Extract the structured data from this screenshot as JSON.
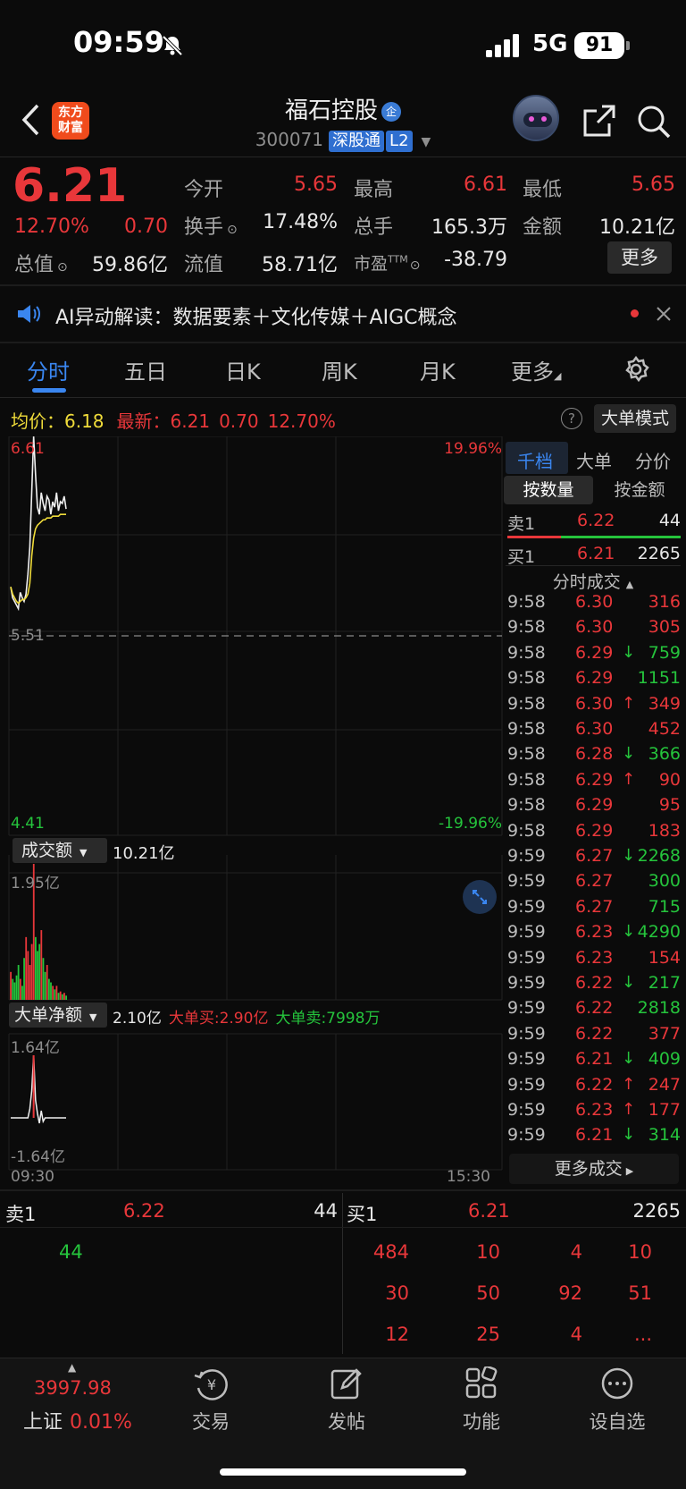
{
  "status": {
    "time": "09:59",
    "network": "5G",
    "battery": "91"
  },
  "header": {
    "logo_line1": "东方",
    "logo_line2": "财富",
    "stock_name": "福石控股",
    "badge": "企",
    "code": "300071",
    "tag": "深股通",
    "level": "L2"
  },
  "quote": {
    "price": "6.21",
    "pct": "12.70%",
    "change": "0.70",
    "open_label": "今开",
    "open": "5.65",
    "high_label": "最高",
    "high": "6.61",
    "low_label": "最低",
    "low": "5.65",
    "turnover_label": "换手",
    "turnover": "17.48%",
    "volume_label": "总手",
    "volume": "165.3万",
    "amount_label": "金额",
    "amount": "10.21亿",
    "mktcap_label": "总值",
    "mktcap": "59.86亿",
    "float_label": "流值",
    "float": "58.71亿",
    "pe_label": "市盈",
    "pe_sup": "TTM",
    "pe": "-38.79",
    "more": "更多"
  },
  "banner": {
    "text": "AI异动解读：数据要素＋文化传媒＋AIGC概念"
  },
  "tabs": [
    "分时",
    "五日",
    "日K",
    "周K",
    "月K",
    "更多"
  ],
  "info": {
    "avg_label": "均价：",
    "avg": "6.18",
    "latest_label": "最新：",
    "latest": "6.21",
    "change": "0.70",
    "pct": "12.70%",
    "mode": "大单模式",
    "help": "?"
  },
  "chart": {
    "top_price": "6.61",
    "top_pct": "19.96%",
    "mid_price": "5.51",
    "bot_price": "4.41",
    "bot_pct": "-19.96%",
    "vol_label": "成交额",
    "vol_total": "10.21亿",
    "vol_max": "1.95亿",
    "net_label": "大单净额",
    "net_total": "2.10亿",
    "net_buy": "大单买:2.90亿",
    "net_sell": "大单卖:7998万",
    "net_max": "1.64亿",
    "net_min": "-1.64亿",
    "start_time": "09:30",
    "end_time": "15:30"
  },
  "chart_data": {
    "type": "line",
    "x_range": [
      "09:30",
      "15:30"
    ],
    "ylim": [
      4.41,
      6.61
    ],
    "prev_close": 5.51,
    "price": [
      5.78,
      5.72,
      5.7,
      5.68,
      5.66,
      5.75,
      5.72,
      5.7,
      5.74,
      5.85,
      6.0,
      6.3,
      6.61,
      6.4,
      6.22,
      6.18,
      6.3,
      6.24,
      6.2,
      6.28,
      6.26,
      6.18,
      6.25,
      6.22,
      6.3,
      6.2,
      6.25,
      6.24,
      6.28,
      6.21
    ],
    "avg_price": [
      5.78,
      5.74,
      5.72,
      5.7,
      5.69,
      5.7,
      5.71,
      5.71,
      5.72,
      5.74,
      5.8,
      5.95,
      6.05,
      6.1,
      6.12,
      6.13,
      6.14,
      6.15,
      6.15,
      6.16,
      6.16,
      6.16,
      6.17,
      6.17,
      6.17,
      6.17,
      6.18,
      6.18,
      6.18,
      6.18
    ],
    "turnover_yi": [
      0.4,
      0.3,
      0.25,
      0.35,
      0.5,
      0.3,
      0.2,
      0.6,
      0.9,
      0.7,
      0.5,
      0.8,
      1.95,
      0.9,
      0.7,
      0.8,
      1.0,
      0.6,
      0.4,
      0.5,
      0.3,
      0.25,
      0.2,
      0.15,
      0.2,
      0.1,
      0.12,
      0.08,
      0.1,
      0.06
    ]
  },
  "right_panel": {
    "tabs": [
      "千档",
      "大单",
      "分价"
    ],
    "seg": [
      "按数量",
      "按金额"
    ],
    "sell1": {
      "label": "卖1",
      "price": "6.22",
      "vol": "44"
    },
    "buy1": {
      "label": "买1",
      "price": "6.21",
      "vol": "2265"
    },
    "title": "分时成交",
    "more": "更多成交",
    "trades": [
      {
        "time": "9:58",
        "price": "6.30",
        "arrow": "",
        "vol": "316",
        "pc": "red",
        "vc": "red"
      },
      {
        "time": "9:58",
        "price": "6.30",
        "arrow": "",
        "vol": "305",
        "pc": "red",
        "vc": "red"
      },
      {
        "time": "9:58",
        "price": "6.29",
        "arrow": "↓",
        "vol": "759",
        "pc": "red",
        "vc": "green"
      },
      {
        "time": "9:58",
        "price": "6.29",
        "arrow": "",
        "vol": "1151",
        "pc": "red",
        "vc": "green"
      },
      {
        "time": "9:58",
        "price": "6.30",
        "arrow": "↑",
        "vol": "349",
        "pc": "red",
        "vc": "red"
      },
      {
        "time": "9:58",
        "price": "6.30",
        "arrow": "",
        "vol": "452",
        "pc": "red",
        "vc": "red"
      },
      {
        "time": "9:58",
        "price": "6.28",
        "arrow": "↓",
        "vol": "366",
        "pc": "red",
        "vc": "green"
      },
      {
        "time": "9:58",
        "price": "6.29",
        "arrow": "↑",
        "vol": "90",
        "pc": "red",
        "vc": "red"
      },
      {
        "time": "9:58",
        "price": "6.29",
        "arrow": "",
        "vol": "95",
        "pc": "red",
        "vc": "red"
      },
      {
        "time": "9:58",
        "price": "6.29",
        "arrow": "",
        "vol": "183",
        "pc": "red",
        "vc": "red"
      },
      {
        "time": "9:59",
        "price": "6.27",
        "arrow": "↓",
        "vol": "2268",
        "pc": "red",
        "vc": "green"
      },
      {
        "time": "9:59",
        "price": "6.27",
        "arrow": "",
        "vol": "300",
        "pc": "red",
        "vc": "green"
      },
      {
        "time": "9:59",
        "price": "6.27",
        "arrow": "",
        "vol": "715",
        "pc": "red",
        "vc": "green"
      },
      {
        "time": "9:59",
        "price": "6.23",
        "arrow": "↓",
        "vol": "4290",
        "pc": "red",
        "vc": "green"
      },
      {
        "time": "9:59",
        "price": "6.23",
        "arrow": "",
        "vol": "154",
        "pc": "red",
        "vc": "red"
      },
      {
        "time": "9:59",
        "price": "6.22",
        "arrow": "↓",
        "vol": "217",
        "pc": "red",
        "vc": "green"
      },
      {
        "time": "9:59",
        "price": "6.22",
        "arrow": "",
        "vol": "2818",
        "pc": "red",
        "vc": "green"
      },
      {
        "time": "9:59",
        "price": "6.22",
        "arrow": "",
        "vol": "377",
        "pc": "red",
        "vc": "red"
      },
      {
        "time": "9:59",
        "price": "6.21",
        "arrow": "↓",
        "vol": "409",
        "pc": "red",
        "vc": "green"
      },
      {
        "time": "9:59",
        "price": "6.22",
        "arrow": "↑",
        "vol": "247",
        "pc": "red",
        "vc": "red"
      },
      {
        "time": "9:59",
        "price": "6.23",
        "arrow": "↑",
        "vol": "177",
        "pc": "red",
        "vc": "red"
      },
      {
        "time": "9:59",
        "price": "6.21",
        "arrow": "↓",
        "vol": "314",
        "pc": "red",
        "vc": "green"
      }
    ]
  },
  "depth": {
    "sell_label": "卖1",
    "sell_price": "6.22",
    "sell_vol": "44",
    "buy_label": "买1",
    "buy_price": "6.21",
    "buy_vol": "2265",
    "sell_orders": [
      "44"
    ],
    "buy_orders": [
      [
        "484",
        "10",
        "4",
        "10"
      ],
      [
        "30",
        "50",
        "92",
        "51"
      ],
      [
        "12",
        "25",
        "4",
        "..."
      ]
    ]
  },
  "nav": {
    "index_value": "3997.98",
    "index_name": "上证",
    "index_pct": "0.01%",
    "items": [
      "交易",
      "发帖",
      "功能",
      "设自选"
    ],
    "trade_glyph": "¥"
  }
}
